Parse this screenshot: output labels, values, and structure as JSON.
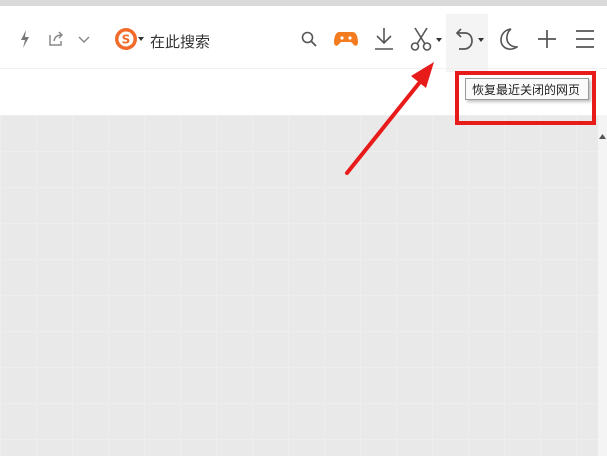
{
  "toolbar": {
    "search_placeholder": "在此搜索",
    "icons": [
      "lightning-icon",
      "share-icon",
      "chevron-down-icon",
      "sogou-logo-icon",
      "search-icon",
      "game-icon",
      "download-icon",
      "scissors-icon",
      "undo-icon",
      "moon-icon",
      "plus-icon",
      "menu-icon"
    ]
  },
  "tooltip": {
    "text": "恢复最近关闭的网页"
  },
  "annotation": {
    "color": "#e81b1b"
  }
}
